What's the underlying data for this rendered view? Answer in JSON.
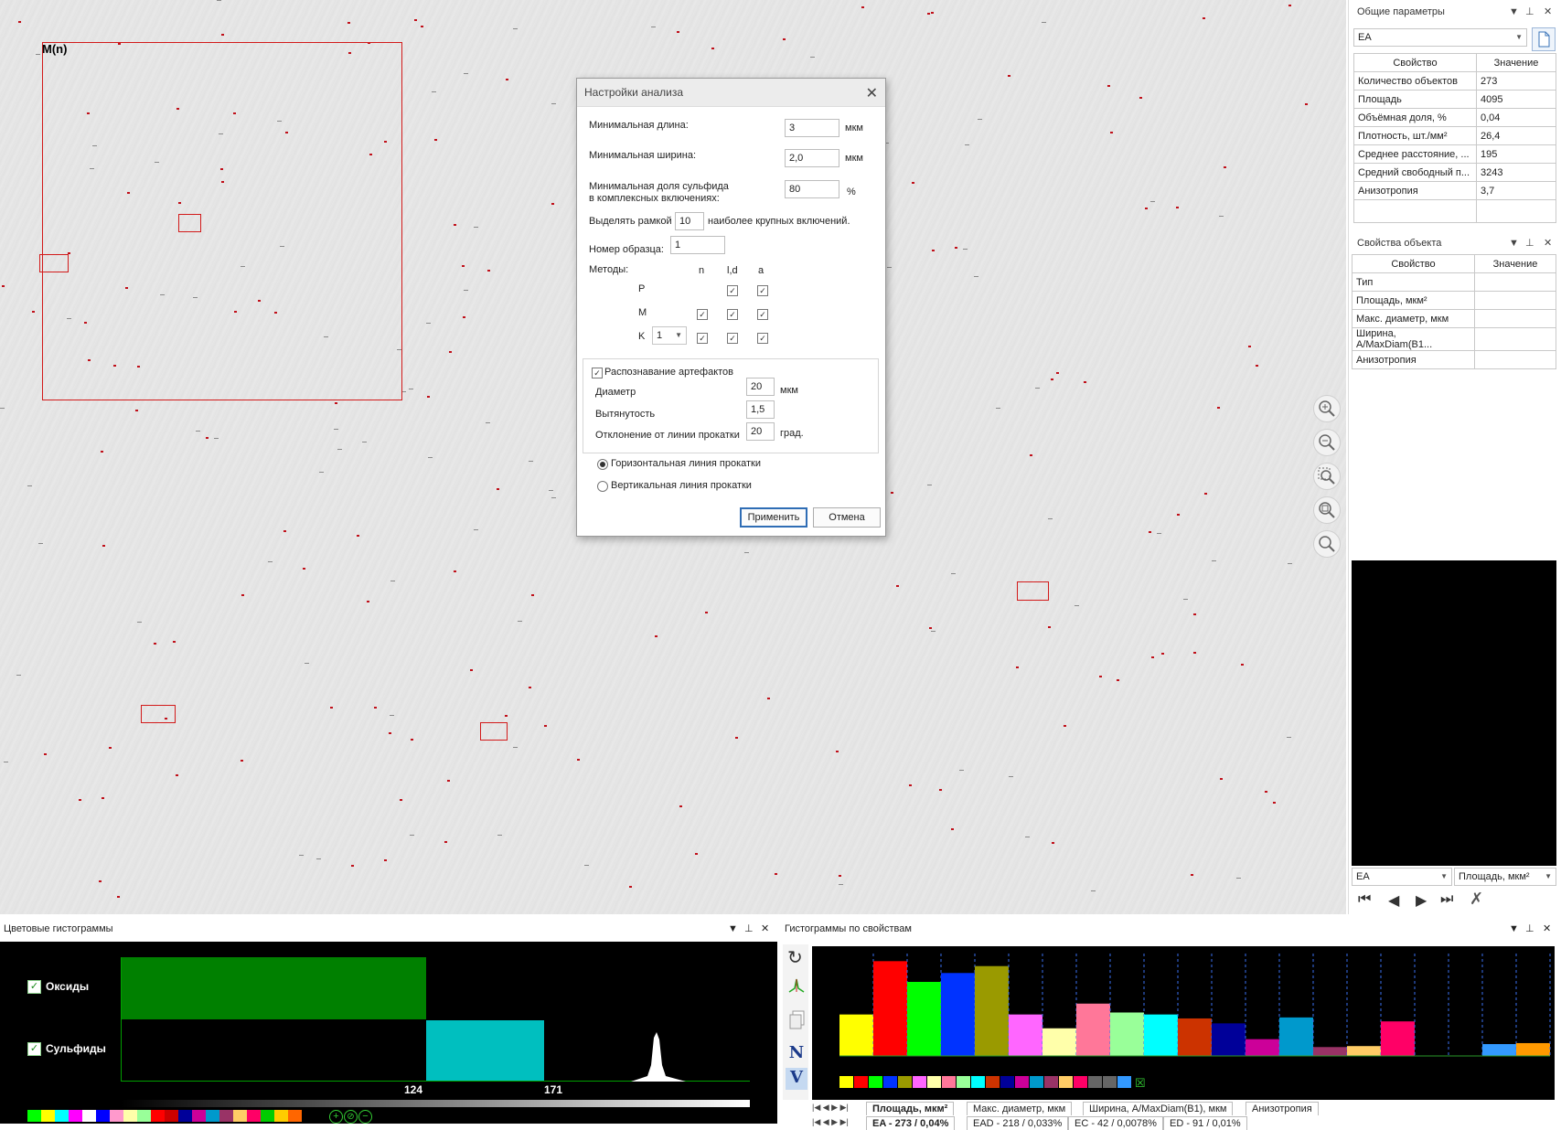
{
  "image": {
    "roi_label": "M(n)"
  },
  "dialog": {
    "title": "Настройки анализа",
    "min_length_label": "Минимальная длина:",
    "min_length_value": "3",
    "min_length_unit": "мкм",
    "min_width_label": "Минимальная ширина:",
    "min_width_value": "2,0",
    "min_width_unit": "мкм",
    "min_sulfide_label_1": "Минимальная доля сульфида",
    "min_sulfide_label_2": "в комплексных включениях:",
    "min_sulfide_value": "80",
    "min_sulfide_unit": "%",
    "frame_label_pre": "Выделять рамкой",
    "frame_value": "10",
    "frame_label_post": "наиболее крупных включений.",
    "sample_label": "Номер образца:",
    "sample_value": "1",
    "methods_label": "Методы:",
    "col_n": "n",
    "col_ld": "l,d",
    "col_a": "a",
    "row_p": "P",
    "row_m": "M",
    "row_k": "K",
    "k_value": "1",
    "artifacts_label": "Распознавание артефактов",
    "diameter_label": "Диаметр",
    "diameter_value": "20",
    "diameter_unit": "мкм",
    "elongation_label": "Вытянутость",
    "elongation_value": "1,5",
    "deviation_label": "Отклонение от линии прокатки",
    "deviation_value": "20",
    "deviation_unit": "град.",
    "radio_horizontal": "Горизонтальная линия прокатки",
    "radio_vertical": "Вертикальная линия прокатки",
    "apply": "Применить",
    "cancel": "Отмена"
  },
  "general_params": {
    "title": "Общие параметры",
    "selector": "EA",
    "col_property": "Свойство",
    "col_value": "Значение",
    "rows": [
      {
        "name": "Количество объектов",
        "value": "273"
      },
      {
        "name": "Площадь",
        "value": "4095"
      },
      {
        "name": "Объёмная доля, %",
        "value": "0,04"
      },
      {
        "name": "Плотность, шт./мм²",
        "value": "26,4"
      },
      {
        "name": "Среднее расстояние, ...",
        "value": "195"
      },
      {
        "name": "Средний свободный п...",
        "value": "3243"
      },
      {
        "name": "Анизотропия",
        "value": "3,7"
      }
    ]
  },
  "object_props": {
    "title": "Свойства объекта",
    "col_property": "Свойство",
    "col_value": "Значение",
    "rows": [
      {
        "name": "Тип",
        "value": ""
      },
      {
        "name": "Площадь, мкм²",
        "value": ""
      },
      {
        "name": "Макс. диаметр, мкм",
        "value": ""
      },
      {
        "name": "Ширина, A/MaxDiam(B1...",
        "value": ""
      },
      {
        "name": "Анизотропия",
        "value": ""
      }
    ],
    "combo_left": "EA",
    "combo_right": "Площадь, мкм²"
  },
  "color_hist": {
    "title": "Цветовые гистограммы",
    "oxides": "Оксиды",
    "sulfides": "Сульфиды",
    "tick_1": "124",
    "tick_2": "171"
  },
  "prop_hist": {
    "title": "Гистограммы по свойствам",
    "tabs": [
      "Площадь, мкм²",
      "Макс. диаметр, мкм",
      "Ширина, A/MaxDiam(B1), мкм",
      "Анизотропия"
    ],
    "class_tabs": [
      "EA - 273 / 0,04%",
      "EAD - 218 / 0,033%",
      "EC - 42 / 0,0078%",
      "ED - 91 / 0,01%"
    ],
    "btn_n": "N",
    "btn_v": "V"
  },
  "chart_data": {
    "type": "bar",
    "bar_colors": [
      "#ffff00",
      "#ff0000",
      "#00ff00",
      "#0033ff",
      "#9a9a00",
      "#ff66ff",
      "#ffffaa",
      "#ff7799",
      "#99ff99",
      "#00ffff",
      "#cc3300",
      "#000099",
      "#cc0099",
      "#0099cc",
      "#993366",
      "#ffcc66",
      "#ff0066",
      "#000000",
      "#000000",
      "#3399ff",
      "#ff9900"
    ],
    "values": [
      0.42,
      0.96,
      0.75,
      0.84,
      0.91,
      0.42,
      0.28,
      0.53,
      0.44,
      0.42,
      0.38,
      0.33,
      0.17,
      0.39,
      0.09,
      0.1,
      0.35,
      0.0,
      0.0,
      0.12,
      0.13
    ],
    "dark_tops": [
      0.96,
      0.96,
      0.75,
      0.84,
      0.91,
      0.42,
      0.28,
      0.53,
      0.44,
      0.42,
      0.38,
      0.33,
      0.17,
      0.39,
      0.09,
      0.1,
      0.35,
      0.0,
      0.0,
      0.12,
      0.13
    ]
  }
}
